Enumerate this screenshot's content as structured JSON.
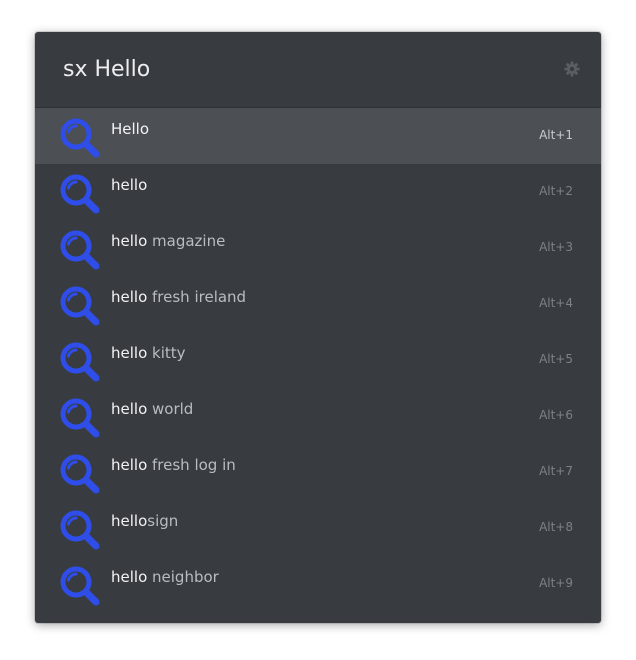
{
  "search": {
    "value": "sx Hello"
  },
  "icons": {
    "settings": "gear-icon",
    "result": "magnifier-search-icon"
  },
  "colors": {
    "background": "#383c41",
    "selected_row": "#4c5055",
    "search_icon": "#2f4de8"
  },
  "results": [
    {
      "bold": "Hello",
      "rest": "",
      "shortcut": "Alt+1",
      "selected": true
    },
    {
      "bold": "hello",
      "rest": "",
      "shortcut": "Alt+2",
      "selected": false
    },
    {
      "bold": "hello",
      "rest": " magazine",
      "shortcut": "Alt+3",
      "selected": false
    },
    {
      "bold": "hello",
      "rest": " fresh ireland",
      "shortcut": "Alt+4",
      "selected": false
    },
    {
      "bold": "hello",
      "rest": " kitty",
      "shortcut": "Alt+5",
      "selected": false
    },
    {
      "bold": "hello",
      "rest": " world",
      "shortcut": "Alt+6",
      "selected": false
    },
    {
      "bold": "hello",
      "rest": " fresh log in",
      "shortcut": "Alt+7",
      "selected": false
    },
    {
      "bold": "hello",
      "rest": "sign",
      "shortcut": "Alt+8",
      "selected": false
    },
    {
      "bold": "hello",
      "rest": " neighbor",
      "shortcut": "Alt+9",
      "selected": false
    }
  ]
}
